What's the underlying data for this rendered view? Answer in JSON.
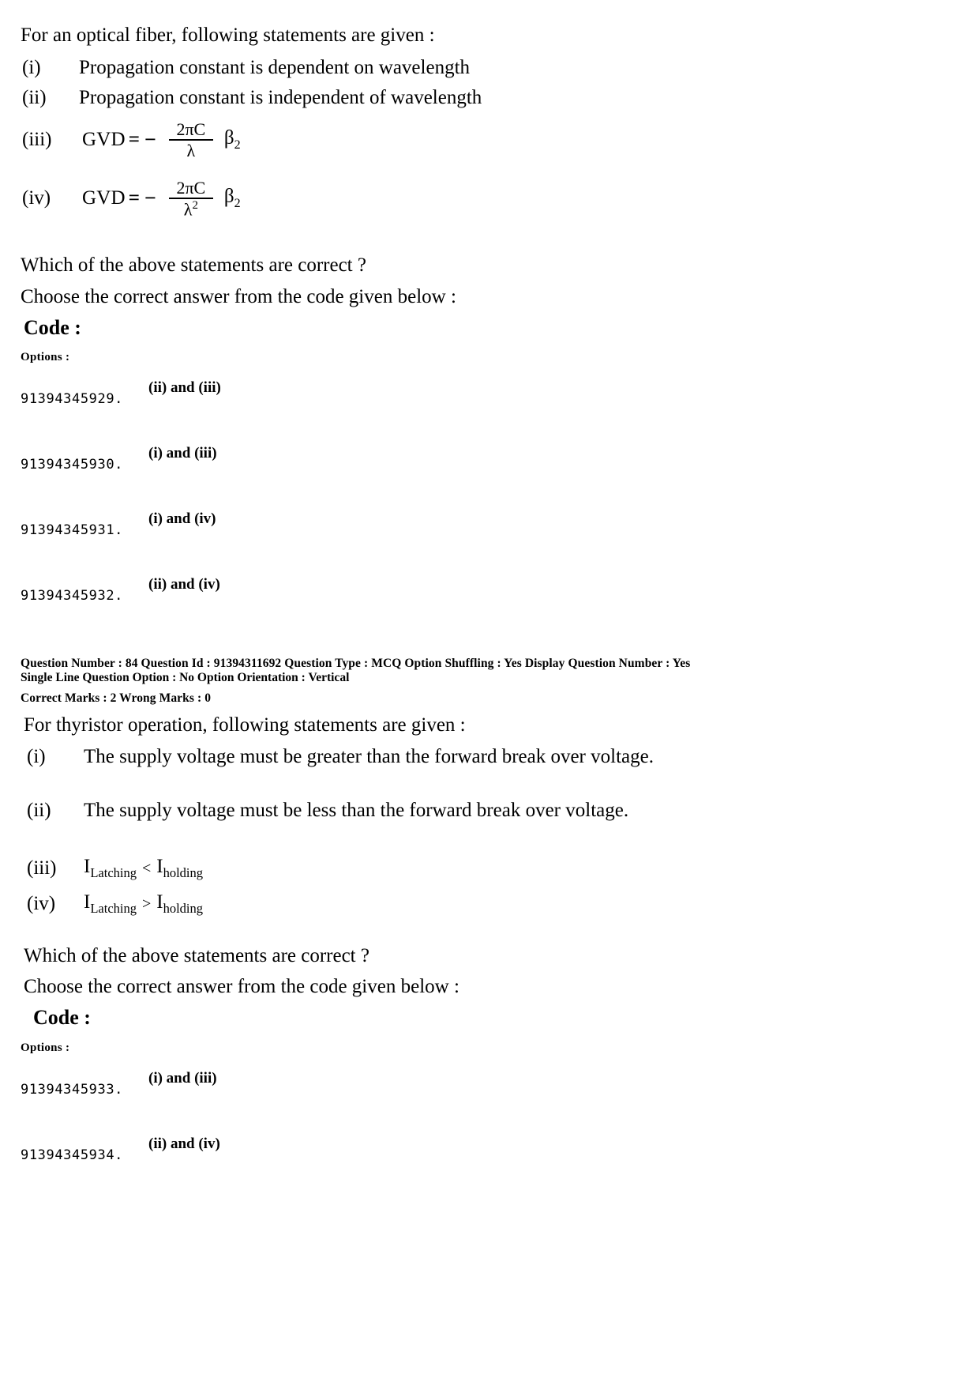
{
  "question_83": {
    "intro": "For an optical fiber, following statements are given :",
    "statements": [
      {
        "label": "(i)",
        "text": "Propagation constant is dependent on wavelength"
      },
      {
        "label": "(ii)",
        "text": "Propagation constant is independent of wavelength"
      }
    ],
    "formulas": [
      {
        "label": "(iii)",
        "lhs": "GVD",
        "equals": "=",
        "minus": "−",
        "numerator": "2πC",
        "denominator": "λ",
        "beta": "β",
        "beta_sub": "2"
      },
      {
        "label": "(iv)",
        "lhs": "GVD",
        "equals": "=",
        "minus": "−",
        "numerator": "2πC",
        "denominator": "λ",
        "denominator_sup": "2",
        "beta": "β",
        "beta_sub": "2"
      }
    ],
    "prompt_line1": "Which of the above statements are correct ?",
    "prompt_line2": "Choose the correct answer from the code given below :",
    "code_label": "Code :",
    "options_label": "Options :",
    "options": [
      {
        "id": "91394345929.",
        "text": "(ii) and (iii)"
      },
      {
        "id": "91394345930.",
        "text": "(i) and (iii)"
      },
      {
        "id": "91394345931.",
        "text": "(i) and (iv)"
      },
      {
        "id": "91394345932.",
        "text": "(ii) and (iv)"
      }
    ]
  },
  "meta_84": {
    "line1": "Question Number : 84  Question Id : 91394311692  Question Type : MCQ  Option Shuffling : Yes  Display Question Number : Yes",
    "line2": "Single Line Question Option : No  Option Orientation : Vertical",
    "marks": "Correct Marks : 2  Wrong Marks : 0"
  },
  "question_84": {
    "intro": "For thyristor operation, following statements are given :",
    "statements": [
      {
        "label": "(i)",
        "text": "The supply voltage must be greater than the forward break over voltage."
      },
      {
        "label": "(ii)",
        "text": "The supply voltage must be less than the forward break over voltage."
      }
    ],
    "inequalities": [
      {
        "label": "(iii)",
        "left_sym": "I",
        "left_sub": "Latching",
        "op": "<",
        "right_sym": "I",
        "right_sub": "holding"
      },
      {
        "label": "(iv)",
        "left_sym": "I",
        "left_sub": "Latching",
        "op": ">",
        "right_sym": "I",
        "right_sub": "holding"
      }
    ],
    "prompt_line1": "Which of the above statements are correct ?",
    "prompt_line2": "Choose the correct answer from the code given below :",
    "code_label": "Code :",
    "options_label": "Options :",
    "options": [
      {
        "id": "91394345933.",
        "text": "(i) and (iii)"
      },
      {
        "id": "91394345934.",
        "text": "(ii) and (iv)"
      }
    ]
  }
}
